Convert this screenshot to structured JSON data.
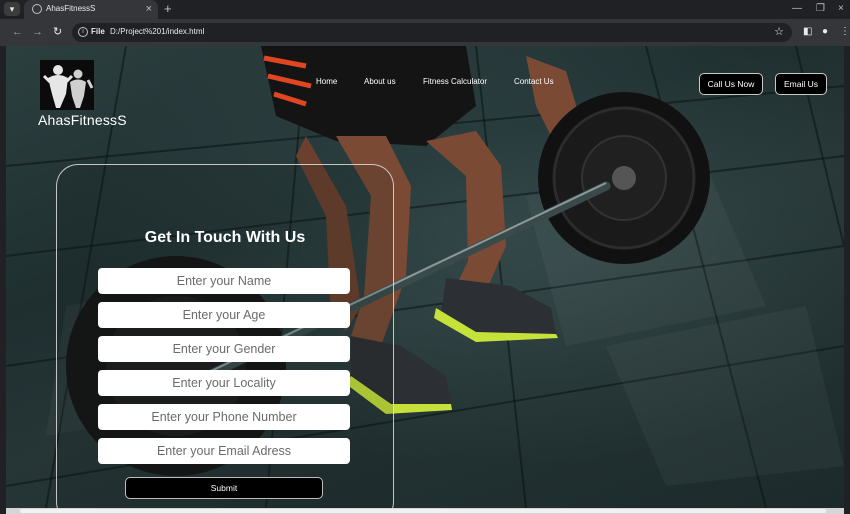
{
  "browser": {
    "tab_title": "AhasFitnessS",
    "url_scheme": "File",
    "url": "D:/Project%201/index.html",
    "icons": [
      "tab-menu-icon",
      "globe-icon",
      "close-icon",
      "plus-icon",
      "back-icon",
      "forward-icon",
      "reload-icon",
      "info-icon",
      "star-icon",
      "sidepanel-icon",
      "profile-icon",
      "menu-icon",
      "minimize-icon",
      "restore-icon",
      "close-window-icon"
    ]
  },
  "site": {
    "brand": "AhasFitnessS",
    "nav": {
      "home": "Home",
      "about": "About us",
      "calculator": "Fitness Calculator",
      "contact": "Contact Us"
    },
    "call_button": "Call Us Now",
    "email_button": "Email Us"
  },
  "form": {
    "title": "Get In Touch With Us",
    "name_placeholder": "Enter your Name",
    "age_placeholder": "Enter your Age",
    "gender_placeholder": "Enter your Gender",
    "locality_placeholder": "Enter your Locality",
    "phone_placeholder": "Enter your Phone Number",
    "email_placeholder": "Enter your Email Adress",
    "submit_label": "Submit"
  },
  "colors": {
    "background": "#263536",
    "accent": "#000000",
    "text": "#ffffff",
    "shoe_accent": "#c6e23a"
  }
}
